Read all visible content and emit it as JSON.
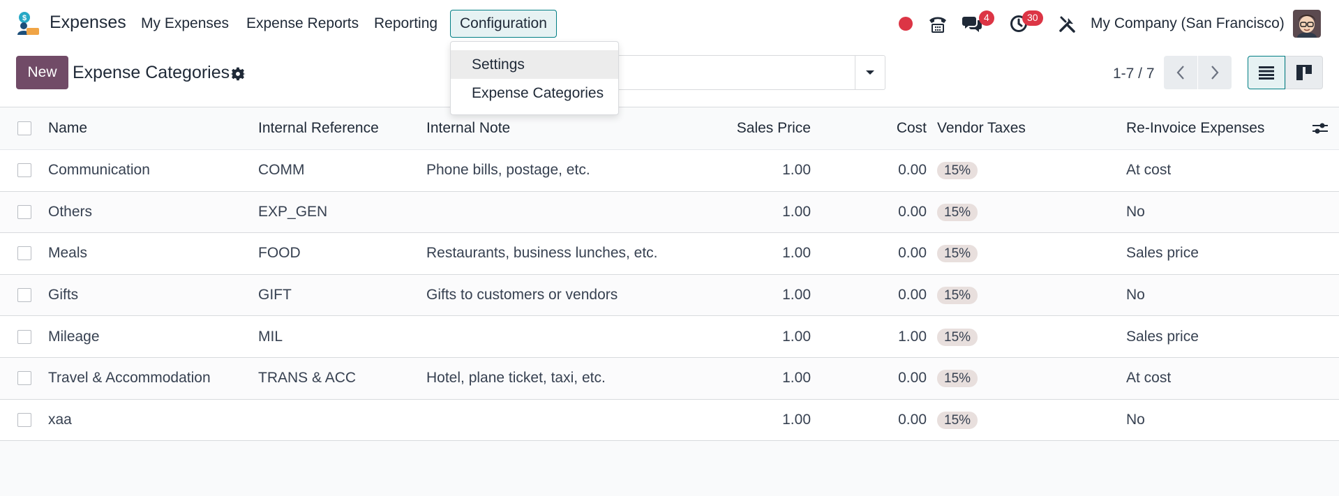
{
  "navbar": {
    "app_name": "Expenses",
    "menu": [
      "My Expenses",
      "Expense Reports",
      "Reporting",
      "Configuration"
    ],
    "active_menu": "Configuration",
    "messages_badge": "4",
    "activities_badge": "30",
    "company": "My Company (San Francisco)"
  },
  "dropdown": {
    "items": [
      "Settings",
      "Expense Categories"
    ]
  },
  "control": {
    "new_label": "New",
    "title": "Expense Categories",
    "pager": "1-7 / 7"
  },
  "table": {
    "columns": [
      "Name",
      "Internal Reference",
      "Internal Note",
      "Sales Price",
      "Cost",
      "Vendor Taxes",
      "Re-Invoice Expenses"
    ],
    "rows": [
      {
        "name": "Communication",
        "ref": "COMM",
        "note": "Phone bills, postage, etc.",
        "price": "1.00",
        "cost": "0.00",
        "tax": "15%",
        "reinvoice": "At cost"
      },
      {
        "name": "Others",
        "ref": "EXP_GEN",
        "note": "",
        "price": "1.00",
        "cost": "0.00",
        "tax": "15%",
        "reinvoice": "No"
      },
      {
        "name": "Meals",
        "ref": "FOOD",
        "note": "Restaurants, business lunches, etc.",
        "price": "1.00",
        "cost": "0.00",
        "tax": "15%",
        "reinvoice": "Sales price"
      },
      {
        "name": "Gifts",
        "ref": "GIFT",
        "note": "Gifts to customers or vendors",
        "price": "1.00",
        "cost": "0.00",
        "tax": "15%",
        "reinvoice": "No"
      },
      {
        "name": "Mileage",
        "ref": "MIL",
        "note": "",
        "price": "1.00",
        "cost": "1.00",
        "tax": "15%",
        "reinvoice": "Sales price"
      },
      {
        "name": "Travel & Accommodation",
        "ref": "TRANS & ACC",
        "note": "Hotel, plane ticket, taxi, etc.",
        "price": "1.00",
        "cost": "0.00",
        "tax": "15%",
        "reinvoice": "At cost"
      },
      {
        "name": "xaa",
        "ref": "",
        "note": "",
        "price": "1.00",
        "cost": "0.00",
        "tax": "15%",
        "reinvoice": "No"
      }
    ]
  },
  "colors": {
    "brand": "#714b67",
    "active_menu_border": "#017e84",
    "badge": "#dc3545",
    "tag_bg": "#e8dfdd"
  }
}
